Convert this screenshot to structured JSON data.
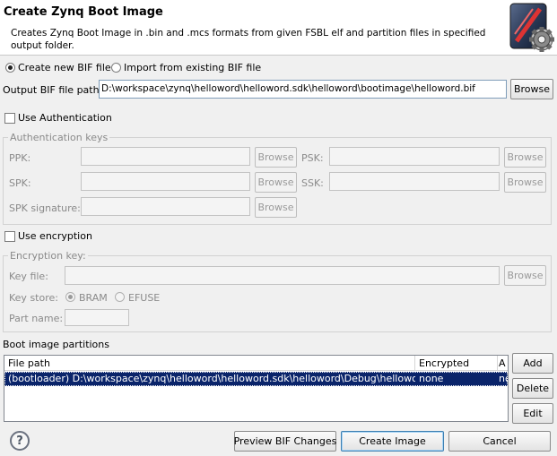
{
  "header": {
    "title": "Create Zynq Boot Image",
    "description": "Creates Zynq Boot Image in .bin and .mcs formats from given FSBL elf and partition files in specified output folder."
  },
  "bif_mode": {
    "new_label": "Create new BIF file",
    "import_label": "Import from existing BIF file",
    "selected": "new"
  },
  "output": {
    "label": "Output BIF file path:",
    "value": "D:\\workspace\\zynq\\helloword\\helloword.sdk\\helloword\\bootimage\\helloword.bif",
    "browse": "Browse"
  },
  "authentication": {
    "checkbox_label": "Use Authentication",
    "checked": false,
    "group_label": "Authentication keys",
    "ppk_label": "PPK:",
    "psk_label": "PSK:",
    "spk_label": "SPK:",
    "ssk_label": "SSK:",
    "spk_signature_label": "SPK signature:",
    "browse": "Browse"
  },
  "encryption": {
    "checkbox_label": "Use encryption",
    "checked": false,
    "group_label": "Encryption key:",
    "key_file_label": "Key file:",
    "key_store_label": "Key store:",
    "bram_label": "BRAM",
    "efuse_label": "EFUSE",
    "part_name_label": "Part name:",
    "browse": "Browse"
  },
  "partitions": {
    "section_label": "Boot image partitions",
    "columns": [
      "File path",
      "Encrypted",
      "A"
    ],
    "rows": [
      {
        "file_path": "(bootloader) D:\\workspace\\zynq\\helloword\\helloword.sdk\\helloword\\Debug\\helloword.elf",
        "encrypted": "none",
        "auth": "no"
      }
    ],
    "add": "Add",
    "delete": "Delete",
    "edit": "Edit"
  },
  "footer": {
    "help": "?",
    "preview": "Preview BIF Changes",
    "create": "Create Image",
    "cancel": "Cancel"
  },
  "icons": {
    "logo": "zynq-boot-image-gear-icon",
    "help": "help-icon"
  }
}
